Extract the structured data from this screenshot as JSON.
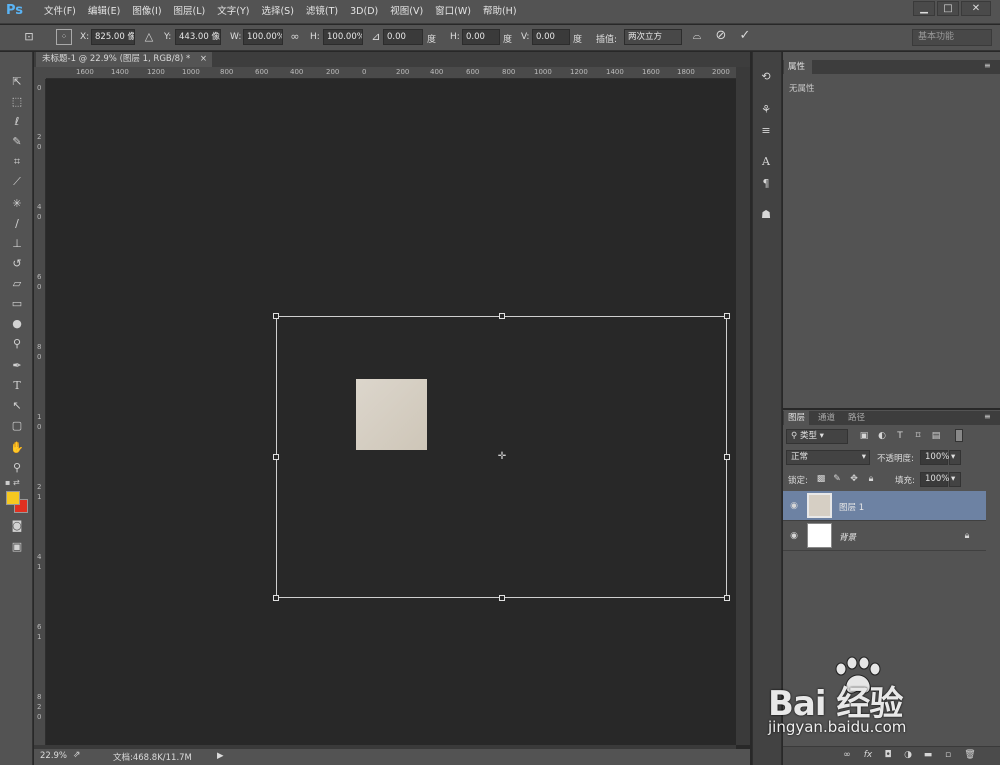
{
  "app": {
    "logo": "Ps"
  },
  "menu": [
    "文件(F)",
    "编辑(E)",
    "图像(I)",
    "图层(L)",
    "文字(Y)",
    "选择(S)",
    "滤镜(T)",
    "3D(D)",
    "视图(V)",
    "窗口(W)",
    "帮助(H)"
  ],
  "window_controls": {
    "minimize": "▁",
    "maximize": "□",
    "close": "✕"
  },
  "options": {
    "x_label": "X:",
    "x_value": "825.00 像素",
    "y_label": "Y:",
    "y_value": "443.00 像素",
    "w_label": "W:",
    "w_value": "100.00%",
    "h_label": "H:",
    "h_value": "100.00%",
    "rotate_value": "0.00",
    "rotate_unit": "度",
    "hskew_label": "H:",
    "hskew_value": "0.00",
    "hskew_unit": "度",
    "vskew_label": "V:",
    "vskew_value": "0.00",
    "vskew_unit": "度",
    "interp_label": "插值:",
    "interp_value": "两次立方",
    "workspace": "基本功能"
  },
  "document": {
    "tab_title": "未标题-1 @ 22.9% (图层 1, RGB/8) *",
    "close": "×"
  },
  "ruler_top": [
    "1600",
    "1400",
    "1200",
    "1000",
    "800",
    "600",
    "400",
    "200",
    "0",
    "200",
    "400",
    "600",
    "800",
    "1000",
    "1200",
    "1400",
    "1600",
    "1800",
    "2000"
  ],
  "ruler_left": [
    "0",
    "2",
    "0",
    "4",
    "0",
    "6",
    "0",
    "8",
    "0",
    "1",
    "0",
    "2",
    "1",
    "4",
    "1",
    "6",
    "1",
    "8",
    "2",
    "0"
  ],
  "status": {
    "zoom": "22.9%",
    "doc": "文档:468.8K/11.7M"
  },
  "properties": {
    "tab": "属性",
    "empty": "无属性"
  },
  "layers": {
    "tabs": [
      "图层",
      "通道",
      "路径"
    ],
    "filter_kind": "类型",
    "blend_mode": "正常",
    "opacity_label": "不透明度:",
    "opacity_value": "100%",
    "lock_label": "锁定:",
    "fill_label": "填充:",
    "fill_value": "100%",
    "items": [
      {
        "name": "图层 1",
        "selected": true
      },
      {
        "name": "背景",
        "selected": false
      }
    ]
  },
  "watermark": {
    "brand": "Bai 经验",
    "url": "jingyan.baidu.com"
  },
  "colors": {
    "foreground": "#f6c820",
    "background": "#e03020",
    "selection": "#6d82a3"
  }
}
